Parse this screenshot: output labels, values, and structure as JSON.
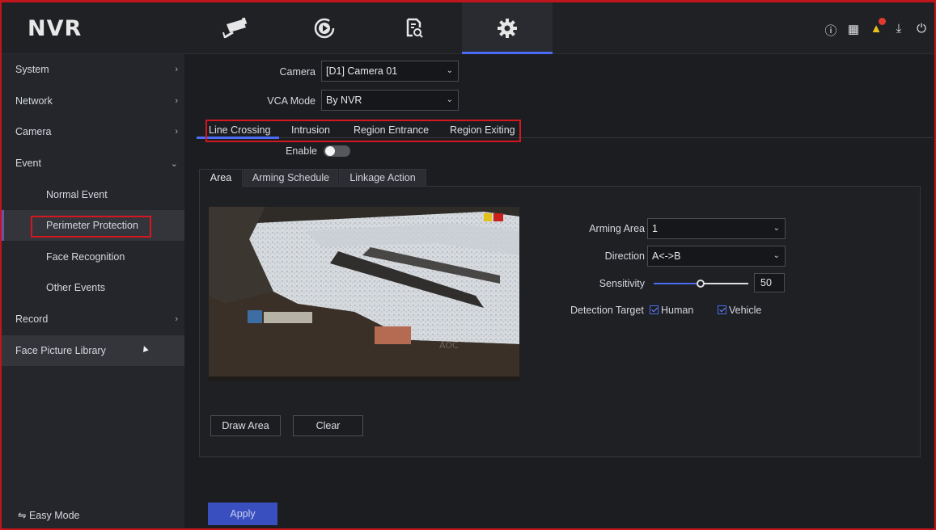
{
  "app": {
    "logo": "NVR"
  },
  "topnav": {
    "items": [
      {
        "name": "live-view",
        "icon": "camera-icon"
      },
      {
        "name": "playback",
        "icon": "playback-icon"
      },
      {
        "name": "search",
        "icon": "file-search-icon"
      },
      {
        "name": "configuration",
        "icon": "gear-icon",
        "active": true
      }
    ],
    "right_icons": [
      "info-icon",
      "qr-code-icon",
      "bell-icon",
      "export-icon",
      "power-icon"
    ]
  },
  "sidebar": {
    "items": [
      {
        "label": "System",
        "arrow": "›"
      },
      {
        "label": "Network",
        "arrow": "›"
      },
      {
        "label": "Camera",
        "arrow": "›"
      },
      {
        "label": "Event",
        "arrow": "⌄"
      },
      {
        "label": "Normal Event"
      },
      {
        "label": "Perimeter Protection",
        "selected": true
      },
      {
        "label": "Face Recognition"
      },
      {
        "label": "Other Events"
      },
      {
        "label": "Record",
        "arrow": "›"
      },
      {
        "label": "Face Picture Library"
      }
    ],
    "easy_mode": "⇋ Easy Mode"
  },
  "form": {
    "camera_label": "Camera",
    "camera_value": "[D1] Camera 01",
    "vca_label": "VCA Mode",
    "vca_value": "By NVR",
    "enable_label": "Enable"
  },
  "tabs": [
    "Line Crossing",
    "Intrusion",
    "Region Entrance",
    "Region Exiting"
  ],
  "subtabs": [
    "Area",
    "Arming Schedule",
    "Linkage Action"
  ],
  "settings": {
    "arming_area_label": "Arming Area",
    "arming_area_value": "1",
    "direction_label": "Direction",
    "direction_value": "A<->B",
    "sensitivity_label": "Sensitivity",
    "sensitivity_value": "50",
    "detection_label": "Detection Target",
    "human_label": "Human",
    "vehicle_label": "Vehicle"
  },
  "buttons": {
    "draw_area": "Draw Area",
    "clear": "Clear",
    "apply": "Apply"
  },
  "colors": {
    "accent": "#4a6cf5",
    "highlight_box": "#d4171f",
    "background": "#1c1d21"
  }
}
